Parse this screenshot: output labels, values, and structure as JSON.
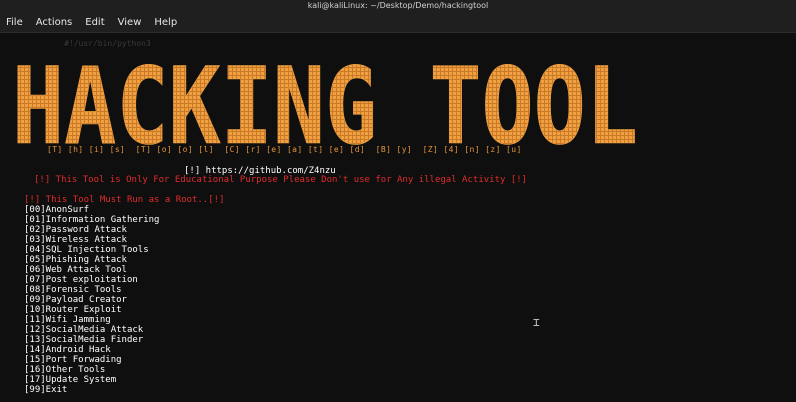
{
  "window": {
    "title": "kali@kaliLinux: ~/Desktop/Demo/hackingtool"
  },
  "menubar": {
    "items": [
      "File",
      "Actions",
      "Edit",
      "View",
      "Help"
    ]
  },
  "banner": {
    "text": "HACKING TOOL",
    "color": "#f0a040"
  },
  "author_line": "[T] [h] [i] [s]  [T] [o] [o] [l]  [C] [r] [e] [a] [t] [e] [d]  [B] [y]  [Z] [4] [n] [z] [u]",
  "github_line": "[!] https://github.com/Z4nzu",
  "warning_educational": "[!] This Tool is Only For Educational Purpose Please Don't use for Any illegal Activity [!]",
  "warning_root": "[!] This Tool Must Run as a Root..[!]",
  "menu_items": [
    "[00]AnonSurf",
    "[01]Information Gathering",
    "[02]Password Attack",
    "[03]Wireless Attack",
    "[04]SQL Injection Tools",
    "[05]Phishing Attack",
    "[06]Web Attack Tool",
    "[07]Post exploitation",
    "[08]Forensic Tools",
    "[09]Payload Creator",
    "[10]Router Exploit",
    "[11]Wifi Jamming",
    "[12]SocialMedia Attack",
    "[13]SocialMedia Finder",
    "[14]Android Hack",
    "[15]Port Forwading",
    "[16]Other Tools",
    "[17]Update System",
    "[99]Exit"
  ],
  "colors": {
    "accent": "#f0a040",
    "warning": "#e02c2c",
    "text": "#ffffff",
    "background": "#0f0f0f"
  }
}
